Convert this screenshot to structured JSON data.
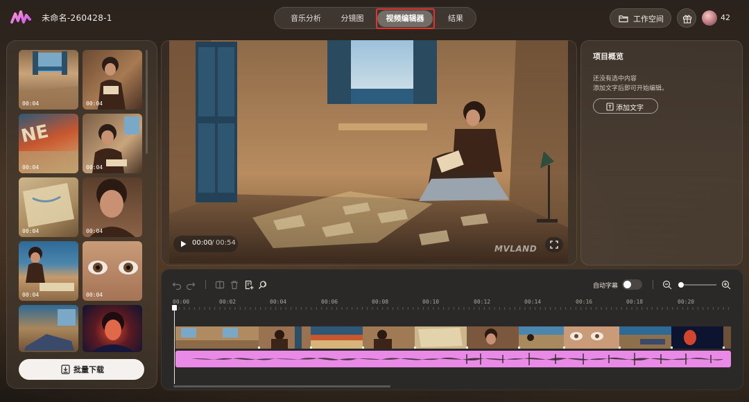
{
  "app": {
    "project_title": "未命名-260428-1",
    "logo_icon": "waveform-logo-icon"
  },
  "tabs": [
    {
      "label": "音乐分析",
      "active": false
    },
    {
      "label": "分镜图",
      "active": false
    },
    {
      "label": "视频编辑器",
      "active": true
    },
    {
      "label": "结果",
      "active": false
    }
  ],
  "header": {
    "workspace_label": "工作空间",
    "credits": "42"
  },
  "clips": [
    {
      "duration": "00:04"
    },
    {
      "duration": "00:04"
    },
    {
      "duration": "00:04"
    },
    {
      "duration": "00:04"
    },
    {
      "duration": "00:04"
    },
    {
      "duration": "00:04"
    },
    {
      "duration": "00:04"
    },
    {
      "duration": "00:04"
    },
    {
      "duration": ""
    },
    {
      "duration": ""
    }
  ],
  "left_panel": {
    "download_label": "批量下载"
  },
  "preview": {
    "current_time": "00:00",
    "separator": " / ",
    "total_time": "00:54",
    "watermark": "MVLAND"
  },
  "project_overview": {
    "title": "项目概览",
    "empty_line1": "还没有选中内容",
    "empty_line2": "添加文字后即可开始编辑。",
    "add_text_label": "添加文字"
  },
  "timeline": {
    "auto_subtitle_label": "自动字幕",
    "auto_subtitle_on": false,
    "zoom_level": 0.05,
    "ruler": [
      "00:00",
      "00:02",
      "00:04",
      "00:06",
      "00:08",
      "00:10",
      "00:12",
      "00:14",
      "00:16",
      "00:18",
      "00:20"
    ]
  },
  "colors": {
    "accent_audio": "#e98ae6",
    "highlight_box": "#e3332f"
  }
}
